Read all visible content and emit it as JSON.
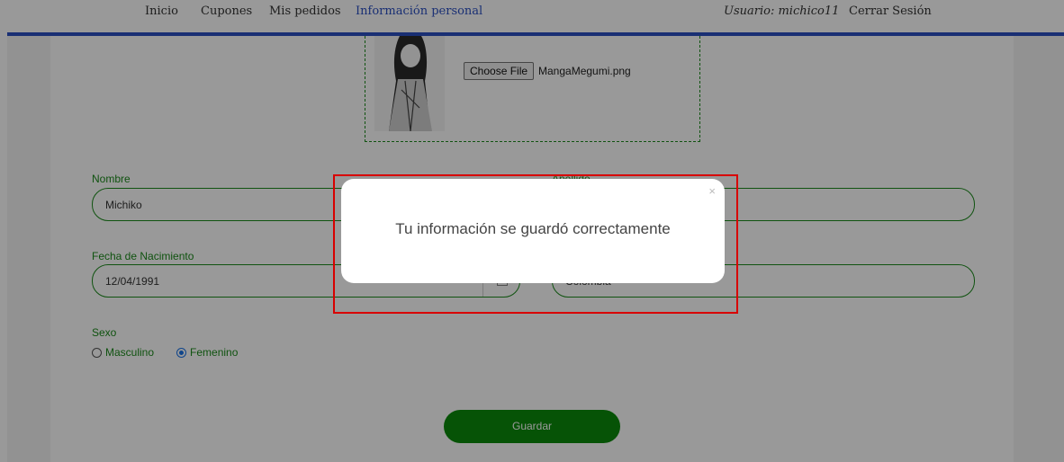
{
  "nav": {
    "inicio": "Inicio",
    "cupones": "Cupones",
    "mis_pedidos": "Mis pedidos",
    "informacion_personal": "Información personal",
    "usuario": "Usuario: michico11",
    "cerrar_sesion": "Cerrar Sesión"
  },
  "upload": {
    "button_label": "Choose File",
    "file_name": "MangaMegumi.png"
  },
  "form": {
    "nombre_label": "Nombre",
    "nombre_value": "Michiko",
    "apellido_label": "Apellido",
    "fecha_label": "Fecha de Nacimiento",
    "fecha_value": "12/04/1991",
    "pais_value": "Colombia",
    "sexo_label": "Sexo",
    "sexo_options": [
      "Masculino",
      "Femenino"
    ],
    "sexo_selected": "Femenino",
    "save_label": "Guardar"
  },
  "modal": {
    "message": "Tu información se guardó correctamente",
    "close_symbol": "×"
  },
  "colors": {
    "accent_green": "#0b8a0b",
    "nav_blue": "#2b4fc2",
    "highlight_red": "#d80000"
  }
}
